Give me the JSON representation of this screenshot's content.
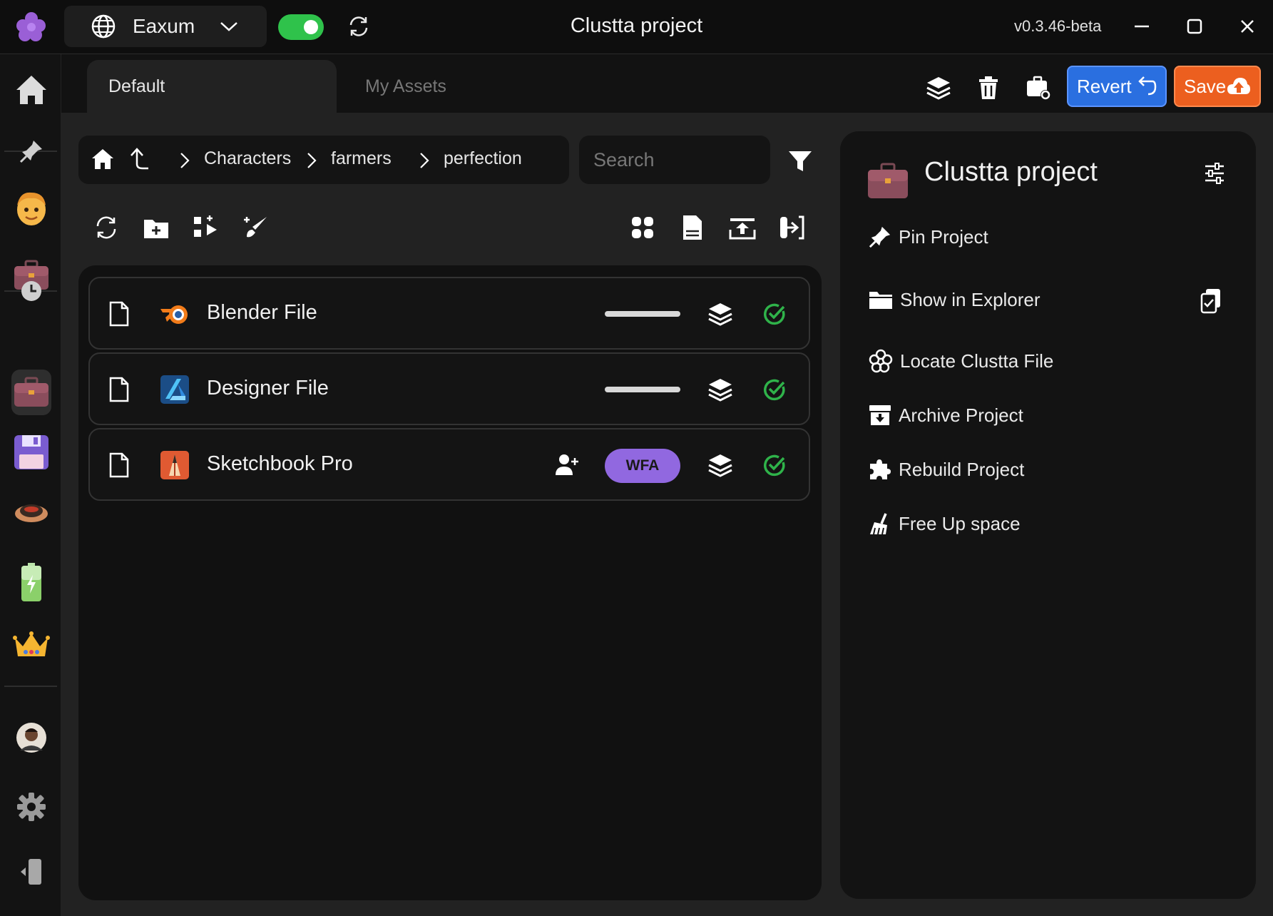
{
  "titlebar": {
    "workspace": "Eaxum",
    "app_title": "Clustta project",
    "version": "v0.3.46-beta",
    "sync_enabled": true
  },
  "tabs": [
    {
      "label": "Default",
      "active": true
    },
    {
      "label": "My Assets",
      "active": false
    }
  ],
  "toolbar": {
    "revert_label": "Revert",
    "save_label": "Save"
  },
  "breadcrumb": {
    "items": [
      "Characters",
      "farmers",
      "perfection"
    ]
  },
  "search": {
    "placeholder": "Search"
  },
  "files": [
    {
      "name": "Blender File",
      "app": "blender-icon",
      "status_tag": null,
      "has_assignee_action": false
    },
    {
      "name": "Designer File",
      "app": "affinity-designer-icon",
      "status_tag": null,
      "has_assignee_action": false
    },
    {
      "name": "Sketchbook Pro",
      "app": "sketchbook-icon",
      "status_tag": "WFA",
      "has_assignee_action": true
    }
  ],
  "project_panel": {
    "title": "Clustta project",
    "actions": [
      {
        "label": "Pin Project",
        "icon": "pin-icon"
      },
      {
        "label": "Show in Explorer",
        "icon": "folder-icon"
      },
      {
        "label": "Locate Clustta File",
        "icon": "clustta-logo-icon"
      },
      {
        "label": "Archive Project",
        "icon": "archive-icon"
      },
      {
        "label": "Rebuild Project",
        "icon": "puzzle-icon"
      },
      {
        "label": "Free Up space",
        "icon": "broom-icon"
      }
    ]
  },
  "colors": {
    "accent_blue": "#2a6fe0",
    "accent_orange": "#ec5f1f",
    "toggle_green": "#2fc24b",
    "status_check": "#2fb34a",
    "wfa_purple": "#9168e0"
  }
}
